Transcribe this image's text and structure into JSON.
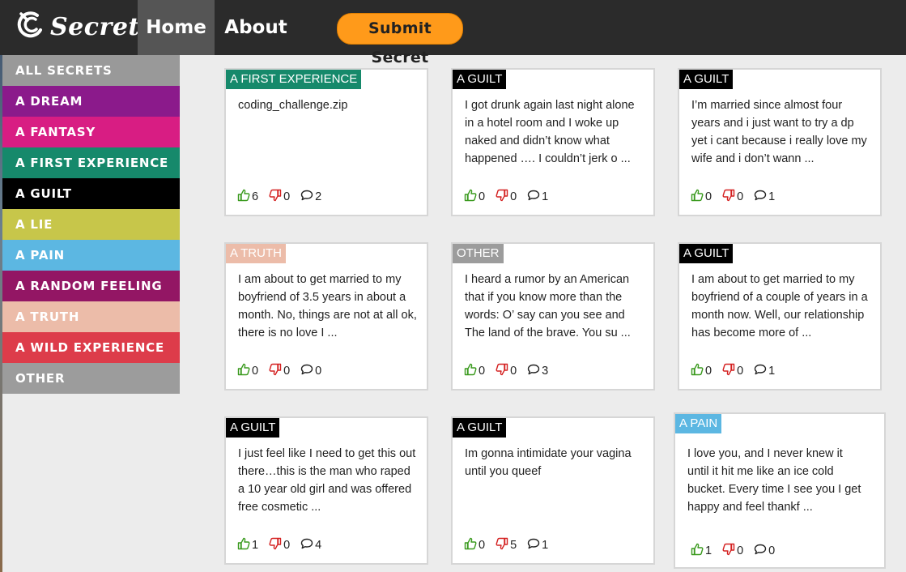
{
  "nav": {
    "logo_text": "Secret",
    "home": "Home",
    "about": "About",
    "submit": "Submit Secret"
  },
  "colors": {
    "navbar": "#2b2b2b",
    "active_nav": "#555555",
    "submit_button": "#ff9a1a",
    "like_green": "#3a9a1e",
    "dislike_red": "#d42020"
  },
  "categories": [
    {
      "label": "ALL SECRETS",
      "color": "#999999"
    },
    {
      "label": "A DREAM",
      "color": "#8b1a8b"
    },
    {
      "label": "A FANTASY",
      "color": "#d81d83"
    },
    {
      "label": "A FIRST EXPERIENCE",
      "color": "#16896b"
    },
    {
      "label": "A GUILT",
      "color": "#000000"
    },
    {
      "label": "A LIE",
      "color": "#c7c64a"
    },
    {
      "label": "A PAIN",
      "color": "#5cb7e2"
    },
    {
      "label": "A RANDOM FEELING",
      "color": "#931664"
    },
    {
      "label": "A TRUTH",
      "color": "#ecbca9"
    },
    {
      "label": "A WILD EXPERIENCE",
      "color": "#dd3c4a"
    },
    {
      "label": "OTHER",
      "color": "#9c9c9c"
    }
  ],
  "cards": [
    {
      "tag": "A FIRST EXPERIENCE",
      "tag_color": "#16896b",
      "text": "coding_challenge.zip",
      "likes": "6",
      "dislikes": "0",
      "comments": "2"
    },
    {
      "tag": "A GUILT",
      "tag_color": "#000000",
      "text": "I got drunk again last night alone in a hotel room and I woke up naked and didn’t know what happened …. I couldn’t jerk o ...",
      "likes": "0",
      "dislikes": "0",
      "comments": "1"
    },
    {
      "tag": "A GUILT",
      "tag_color": "#000000",
      "text": "I’m married since almost four years and i just want to try a dp yet i cant because i really love my wife and i don’t wann ...",
      "likes": "0",
      "dislikes": "0",
      "comments": "1"
    },
    {
      "tag": "A TRUTH",
      "tag_color": "#ecbca9",
      "text": "I am about to get married to my boyfriend of 3.5 years in about a month. No, things are not at all ok, there is no love I ...",
      "likes": "0",
      "dislikes": "0",
      "comments": "0"
    },
    {
      "tag": "OTHER",
      "tag_color": "#9c9c9c",
      "text": "I heard a rumor by an American that if you know more than the words: O’ say can you see and The land of the brave. You su ...",
      "likes": "0",
      "dislikes": "0",
      "comments": "3"
    },
    {
      "tag": "A GUILT",
      "tag_color": "#000000",
      "text": "I am about to get married to my boyfriend of a couple of years in a month now. Well, our relationship has become more of ...",
      "likes": "0",
      "dislikes": "0",
      "comments": "1"
    },
    {
      "tag": "A GUILT",
      "tag_color": "#000000",
      "text": "I just feel like I need to get this out there…this is the man who raped a 10 year old girl and was offered free cosmetic ...",
      "likes": "1",
      "dislikes": "0",
      "comments": "4"
    },
    {
      "tag": "A GUILT",
      "tag_color": "#000000",
      "text": "Im gonna intimidate your vagina until you queef",
      "likes": "0",
      "dislikes": "5",
      "comments": "1"
    },
    {
      "tag": "A PAIN",
      "tag_color": "#5cb7e2",
      "text": "I love you, and I never knew it until it hit me like an ice cold bucket. Every time I see you I get happy and feel thankf ...",
      "likes": "1",
      "dislikes": "0",
      "comments": "0"
    }
  ]
}
